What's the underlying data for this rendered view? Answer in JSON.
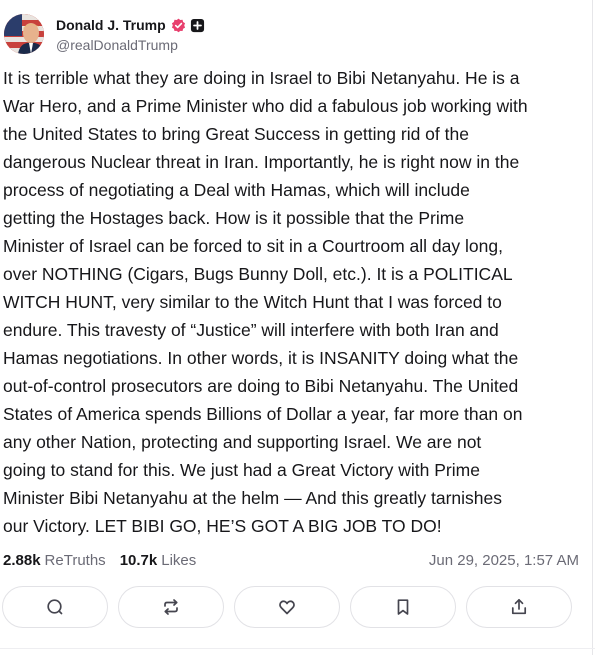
{
  "author": {
    "display_name": "Donald J. Trump",
    "handle": "@realDonaldTrump",
    "avatar_icon": "profile-avatar",
    "verified_icon": "verified-badge-icon",
    "badge_icon": "plus-badge-icon"
  },
  "post": {
    "lines": [
      "It is terrible what they are doing in Israel to Bibi Netanyahu. He is a",
      "War Hero, and a Prime Minister who did a fabulous job working with",
      "the United States to bring Great Success in getting rid of the",
      "dangerous Nuclear threat in Iran. Importantly, he is right now in the",
      "process of negotiating a Deal with Hamas, which will include",
      "getting the Hostages back. How is it possible that the Prime",
      "Minister of Israel can be forced to sit in a Courtroom all day long,",
      "over NOTHING (Cigars, Bugs Bunny Doll, etc.). It is a POLITICAL",
      "WITCH HUNT, very similar to the Witch Hunt that I was forced to",
      "endure. This travesty of “Justice” will interfere with both Iran and",
      "Hamas negotiations. In other words, it is INSANITY doing what the",
      "out-of-control prosecutors are doing to Bibi Netanyahu. The United",
      "States of America spends Billions of Dollar a year, far more than on",
      "any other Nation, protecting and supporting Israel. We are not",
      "going to stand for this. We just had a Great Victory with Prime",
      "Minister Bibi Netanyahu at the helm — And this greatly tarnishes",
      "our Victory. LET BIBI GO, HE’S GOT A BIG JOB TO DO!"
    ]
  },
  "stats": {
    "retruths_count": "2.88k",
    "retruths_label": "ReTruths",
    "likes_count": "10.7k",
    "likes_label": "Likes",
    "timestamp": "Jun 29, 2025, 1:57 AM"
  },
  "actions": [
    {
      "name": "reply-button",
      "icon": "comment-icon"
    },
    {
      "name": "retruth-button",
      "icon": "repost-icon"
    },
    {
      "name": "like-button",
      "icon": "heart-icon"
    },
    {
      "name": "bookmark-button",
      "icon": "bookmark-icon"
    },
    {
      "name": "share-button",
      "icon": "share-icon"
    }
  ],
  "colors": {
    "text": "#17171a",
    "muted": "#6b6b76",
    "verified": "#e8406e",
    "border": "#e2e2e6"
  }
}
